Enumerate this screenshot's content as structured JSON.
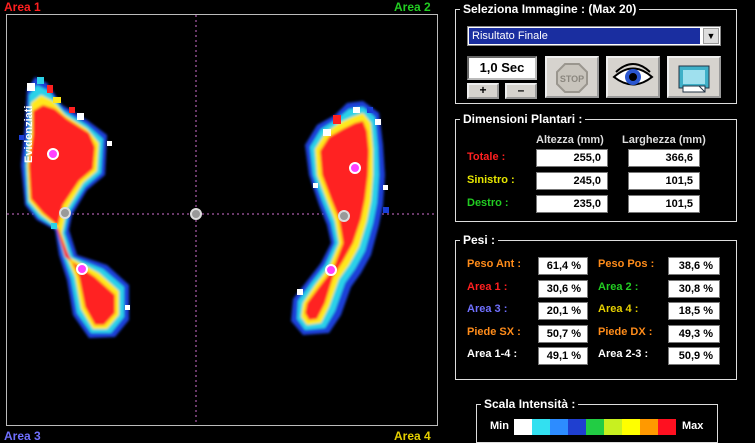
{
  "areas": {
    "area1": {
      "label": "Area 1",
      "color": "#ff2020"
    },
    "area2": {
      "label": "Area 2",
      "color": "#22cc22"
    },
    "area3": {
      "label": "Area 3",
      "color": "#7070ff"
    },
    "area4": {
      "label": "Area 4",
      "color": "#e6d000"
    }
  },
  "side_text": "Evidenziati",
  "selezione": {
    "legend": "Seleziona Immagine : (Max 20)",
    "selected": "Risultato Finale",
    "timer": "1,0 Sec",
    "plus": "+",
    "minus": "–",
    "stop": "STOP"
  },
  "dimensioni": {
    "legend": "Dimensioni Plantari :",
    "col_altezza": "Altezza (mm)",
    "col_larghezza": "Larghezza (mm)",
    "rows": [
      {
        "label": "Totale :",
        "color": "#ff2020",
        "altezza": "255,0",
        "larghezza": "366,6"
      },
      {
        "label": "Sinistro :",
        "color": "#e6e600",
        "altezza": "245,0",
        "larghezza": "101,5"
      },
      {
        "label": "Destro :",
        "color": "#22cc22",
        "altezza": "235,0",
        "larghezza": "101,5"
      }
    ]
  },
  "pesi": {
    "legend": "Pesi :",
    "rows": [
      {
        "l1": "Peso Ant :",
        "c1": "#ff8c1a",
        "v1": "61,4 %",
        "l2": "Peso Pos :",
        "c2": "#ff8c1a",
        "v2": "38,6 %"
      },
      {
        "l1": "Area 1 :",
        "c1": "#ff2020",
        "v1": "30,6 %",
        "l2": "Area 2 :",
        "c2": "#22cc22",
        "v2": "30,8 %"
      },
      {
        "l1": "Area 3 :",
        "c1": "#7070ff",
        "v1": "20,1 %",
        "l2": "Area 4 :",
        "c2": "#e6d000",
        "v2": "18,5 %"
      },
      {
        "l1": "Piede SX :",
        "c1": "#ff8c1a",
        "v1": "50,7 %",
        "l2": "Piede DX :",
        "c2": "#ff8c1a",
        "v2": "49,3 %"
      },
      {
        "l1": "Area 1-4 :",
        "c1": "#ffffff",
        "v1": "49,1 %",
        "l2": "Area 2-3 :",
        "c2": "#ffffff",
        "v2": "50,9 %"
      }
    ]
  },
  "scala": {
    "legend": "Scala Intensità :",
    "min": "Min",
    "max": "Max",
    "colors": [
      "#ffffff",
      "#33e0f0",
      "#2d8cff",
      "#1f3fd0",
      "#22cc44",
      "#c8f020",
      "#ffff00",
      "#ff9900",
      "#ff1020"
    ]
  }
}
